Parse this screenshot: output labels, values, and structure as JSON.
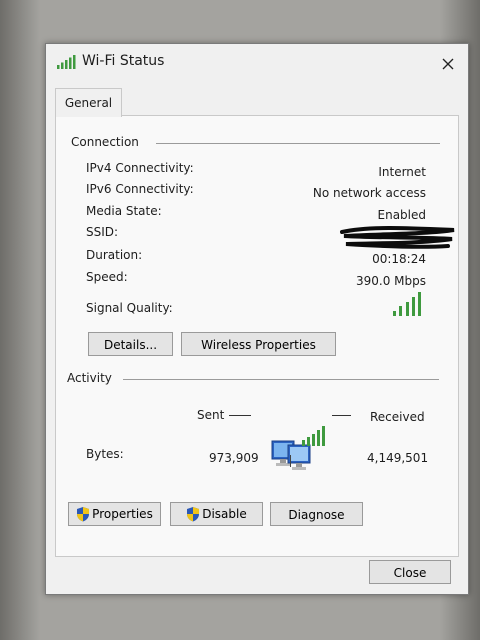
{
  "window": {
    "title": "Wi-Fi Status",
    "close_icon": "close-x-icon",
    "title_icon": "wifi-signal-icon"
  },
  "tabs": [
    {
      "label": "General",
      "selected": true
    }
  ],
  "connection": {
    "section_label": "Connection",
    "rows": [
      {
        "label": "IPv4 Connectivity:",
        "value": "Internet"
      },
      {
        "label": "IPv6 Connectivity:",
        "value": "No network access"
      },
      {
        "label": "Media State:",
        "value": "Enabled"
      },
      {
        "label": "SSID:",
        "value": ""
      },
      {
        "label": "Duration:",
        "value": "00:18:24"
      },
      {
        "label": "Speed:",
        "value": "390.0 Mbps"
      }
    ],
    "signal_quality_label": "Signal Quality:",
    "signal_bars_total": 5,
    "signal_bars_on": 5,
    "details_button": "Details...",
    "wireless_properties_button": "Wireless Properties"
  },
  "activity": {
    "section_label": "Activity",
    "sent_label": "Sent",
    "received_label": "Received",
    "bytes_label": "Bytes:",
    "bytes_sent": "973,909",
    "bytes_received": "4,149,501"
  },
  "buttons": {
    "properties": "Properties",
    "disable": "Disable",
    "diagnose": "Diagnose",
    "close": "Close"
  },
  "colors": {
    "signal_green": "#3f9a3f",
    "shield_blue": "#2b58b6",
    "shield_yellow": "#f0c419",
    "window_bg": "#f0f0f0"
  }
}
